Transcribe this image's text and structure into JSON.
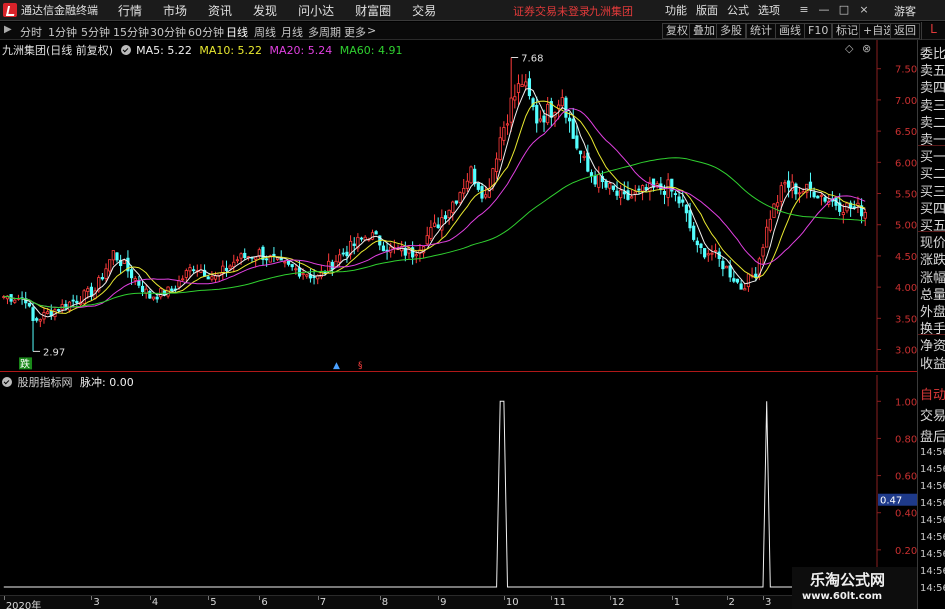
{
  "app": {
    "title": "通达信金融终端",
    "menu": [
      "行情",
      "市场",
      "资讯",
      "发现",
      "问小达",
      "财富圈",
      "交易"
    ],
    "login_warning": "证券交易未登录",
    "stock_name": "九洲集团",
    "right_menu": [
      "功能",
      "版面",
      "公式",
      "选项"
    ],
    "guest_label": "游客",
    "window_buttons": {
      "menu": "≡",
      "minimize": "—",
      "maximize": "□",
      "close": "×"
    }
  },
  "toolbar": {
    "periods": [
      {
        "label": "分时",
        "active": false
      },
      {
        "label": "1分钟",
        "active": false
      },
      {
        "label": "5分钟",
        "active": false
      },
      {
        "label": "15分钟",
        "active": false
      },
      {
        "label": "30分钟",
        "active": false
      },
      {
        "label": "60分钟",
        "active": false
      },
      {
        "label": "日线",
        "active": true
      },
      {
        "label": "周线",
        "active": false
      },
      {
        "label": "月线",
        "active": false
      },
      {
        "label": "多周期",
        "active": false
      },
      {
        "label": "更多",
        "active": false
      }
    ],
    "more_arrow": ">",
    "buttons": [
      "复权",
      "叠加",
      "多股",
      "统计",
      "画线",
      "F10",
      "标记",
      "+自选",
      "返回"
    ],
    "panel_mark": "L"
  },
  "main_chart": {
    "stock_title": "九洲集团(日线 前复权)",
    "ma": [
      {
        "label": "MA5:",
        "value": "5.22",
        "color": "#f0f0f0"
      },
      {
        "label": "MA10:",
        "value": "5.22",
        "color": "#e8e830"
      },
      {
        "label": "MA20:",
        "value": "5.24",
        "color": "#e040e0"
      },
      {
        "label": "MA60:",
        "value": "4.91",
        "color": "#30d030"
      }
    ],
    "high_marker": "7.68",
    "low_marker": "2.97",
    "limit_down_badge": "跌",
    "event_marks": [
      "▲",
      "§"
    ],
    "colors": {
      "up": "#ff3c3c",
      "down": "#54ffff",
      "grid": "#7a1010",
      "axis": "#8a2020"
    }
  },
  "indicator": {
    "name": "股朋指标网",
    "series_label": "脉冲:",
    "series_value": "0.00",
    "current_marker": "0.47"
  },
  "quote_panel": {
    "labels": [
      "委比",
      "卖五",
      "卖四",
      "卖三",
      "卖二",
      "卖一",
      "买一",
      "买二",
      "买三",
      "买四",
      "买五",
      "现价",
      "涨跌",
      "涨幅",
      "总量",
      "外盘",
      "换手",
      "净资",
      "收益"
    ],
    "lower_labels": [
      "自动",
      "交易",
      "盘后"
    ],
    "times": [
      "14:56",
      "14:56",
      "14:56",
      "14:56",
      "14:56",
      "14:56",
      "14:56",
      "14:56",
      "14:56"
    ]
  },
  "watermark": {
    "title": "乐淘公式网",
    "url": "www.60lt.com"
  },
  "chart_data": [
    {
      "type": "candlestick",
      "title": "九洲集团(日线 前复权)",
      "y_ticks": [
        "7.50",
        "7.00",
        "6.50",
        "6.00",
        "5.50",
        "5.00",
        "4.50",
        "4.00",
        "3.50",
        "3.00"
      ],
      "ylim": [
        2.8,
        7.8
      ],
      "x_labels": [
        "2020年",
        "3",
        "4",
        "5",
        "6",
        "7",
        "8",
        "9",
        "10",
        "11",
        "12",
        "1",
        "2",
        "3"
      ],
      "x_label_bar_index": [
        0,
        24,
        40,
        56,
        70,
        86,
        103,
        119,
        137,
        150,
        166,
        183,
        198,
        208
      ],
      "bar_count": 237,
      "close_path": [
        [
          0,
          3.85
        ],
        [
          6,
          3.82
        ],
        [
          8,
          3.45
        ],
        [
          12,
          3.58
        ],
        [
          18,
          3.75
        ],
        [
          25,
          3.95
        ],
        [
          30,
          4.55
        ],
        [
          35,
          4.2
        ],
        [
          40,
          3.85
        ],
        [
          46,
          3.95
        ],
        [
          52,
          4.35
        ],
        [
          58,
          4.15
        ],
        [
          64,
          4.45
        ],
        [
          70,
          4.55
        ],
        [
          76,
          4.35
        ],
        [
          82,
          4.25
        ],
        [
          86,
          4.15
        ],
        [
          92,
          4.5
        ],
        [
          100,
          4.85
        ],
        [
          106,
          4.6
        ],
        [
          112,
          4.55
        ],
        [
          118,
          4.95
        ],
        [
          124,
          5.45
        ],
        [
          128,
          5.85
        ],
        [
          132,
          5.45
        ],
        [
          136,
          6.4
        ],
        [
          139,
          6.95
        ],
        [
          142,
          7.3
        ],
        [
          146,
          6.7
        ],
        [
          150,
          6.85
        ],
        [
          153,
          7.1
        ],
        [
          156,
          6.4
        ],
        [
          160,
          5.85
        ],
        [
          165,
          5.6
        ],
        [
          170,
          5.4
        ],
        [
          176,
          5.55
        ],
        [
          182,
          5.6
        ],
        [
          186,
          5.3
        ],
        [
          190,
          4.6
        ],
        [
          194,
          4.55
        ],
        [
          198,
          4.3
        ],
        [
          202,
          4.0
        ],
        [
          206,
          4.25
        ],
        [
          210,
          5.15
        ],
        [
          214,
          5.65
        ],
        [
          218,
          5.55
        ],
        [
          222,
          5.55
        ],
        [
          226,
          5.4
        ],
        [
          230,
          5.3
        ],
        [
          234,
          5.25
        ],
        [
          236,
          5.22
        ]
      ],
      "ma_final": {
        "MA5": 5.22,
        "MA10": 5.22,
        "MA20": 5.24,
        "MA60": 4.91
      },
      "high": 7.68,
      "low": 2.97,
      "high_bar_index": 139,
      "low_bar_index": 8
    },
    {
      "type": "line",
      "series": [
        {
          "name": "脉冲",
          "values_at_bars": {
            "136": 1.0,
            "137": 1.0,
            "209": 1.0
          },
          "default": 0.0
        }
      ],
      "y_ticks": [
        "1.00",
        "0.80",
        "0.60",
        "0.47",
        "0.40",
        "0.20"
      ],
      "ylim": [
        0.0,
        1.05
      ]
    }
  ]
}
